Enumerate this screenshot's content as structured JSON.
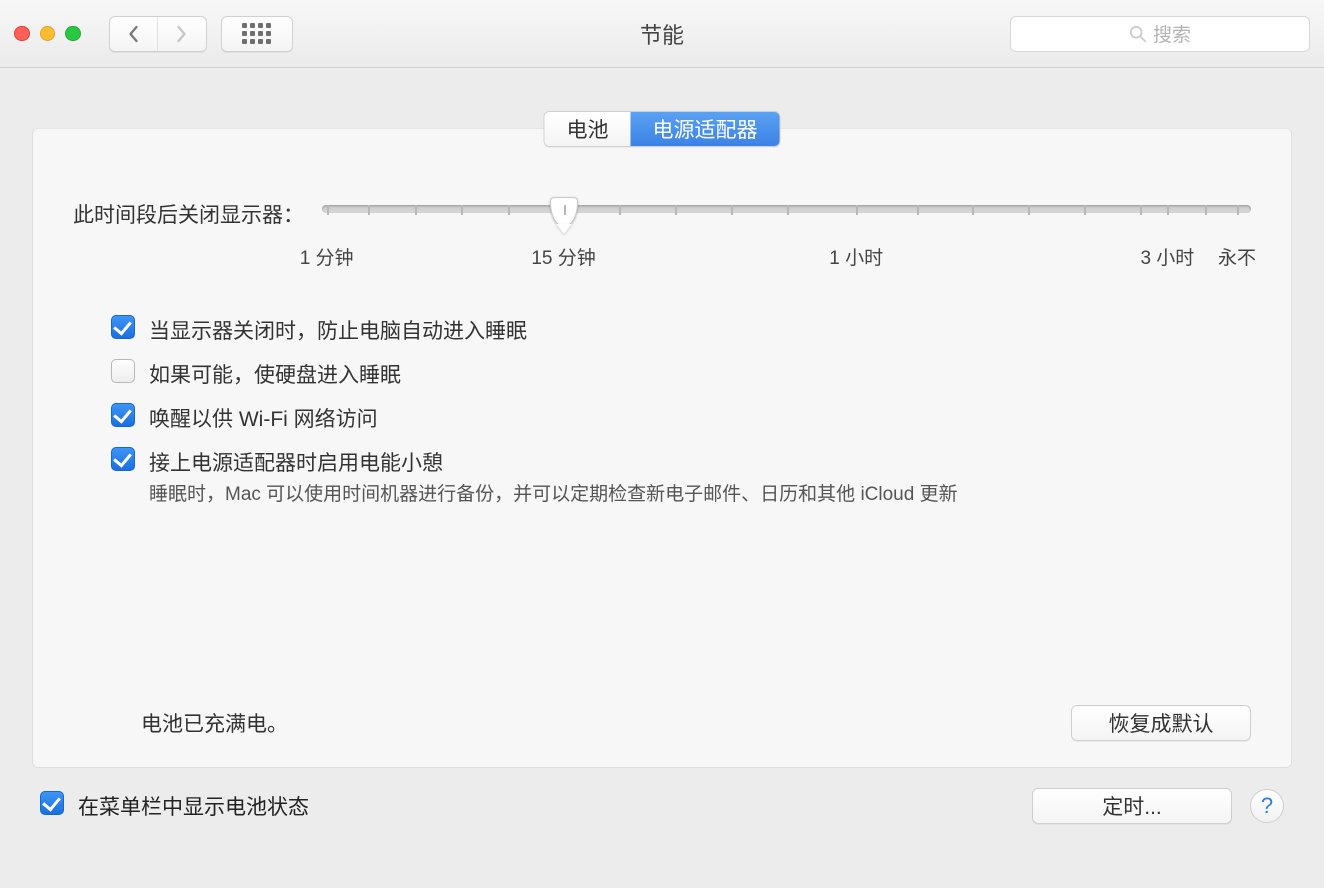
{
  "toolbar": {
    "title": "节能",
    "search_placeholder": "搜索"
  },
  "tabs": {
    "battery": "电池",
    "power_adapter": "电源适配器"
  },
  "slider": {
    "label": "此时间段后关闭显示器：",
    "ticks": {
      "min": "1 分钟",
      "fifteen": "15 分钟",
      "one_hour": "1 小时",
      "three_hours": "3 小时",
      "never": "永不"
    },
    "thumb_percent": 26
  },
  "options": [
    {
      "checked": true,
      "label": "当显示器关闭时，防止电脑自动进入睡眠"
    },
    {
      "checked": false,
      "label": "如果可能，使硬盘进入睡眠"
    },
    {
      "checked": true,
      "label": "唤醒以供 Wi-Fi 网络访问"
    },
    {
      "checked": true,
      "label": "接上电源适配器时启用电能小憩",
      "sub": "睡眠时，Mac 可以使用时间机器进行备份，并可以定期检查新电子邮件、日历和其他 iCloud 更新"
    }
  ],
  "battery_status": "电池已充满电。",
  "buttons": {
    "restore_defaults": "恢复成默认",
    "schedule": "定时..."
  },
  "menubar_battery": {
    "checked": true,
    "label": "在菜单栏中显示电池状态"
  },
  "help": "?"
}
